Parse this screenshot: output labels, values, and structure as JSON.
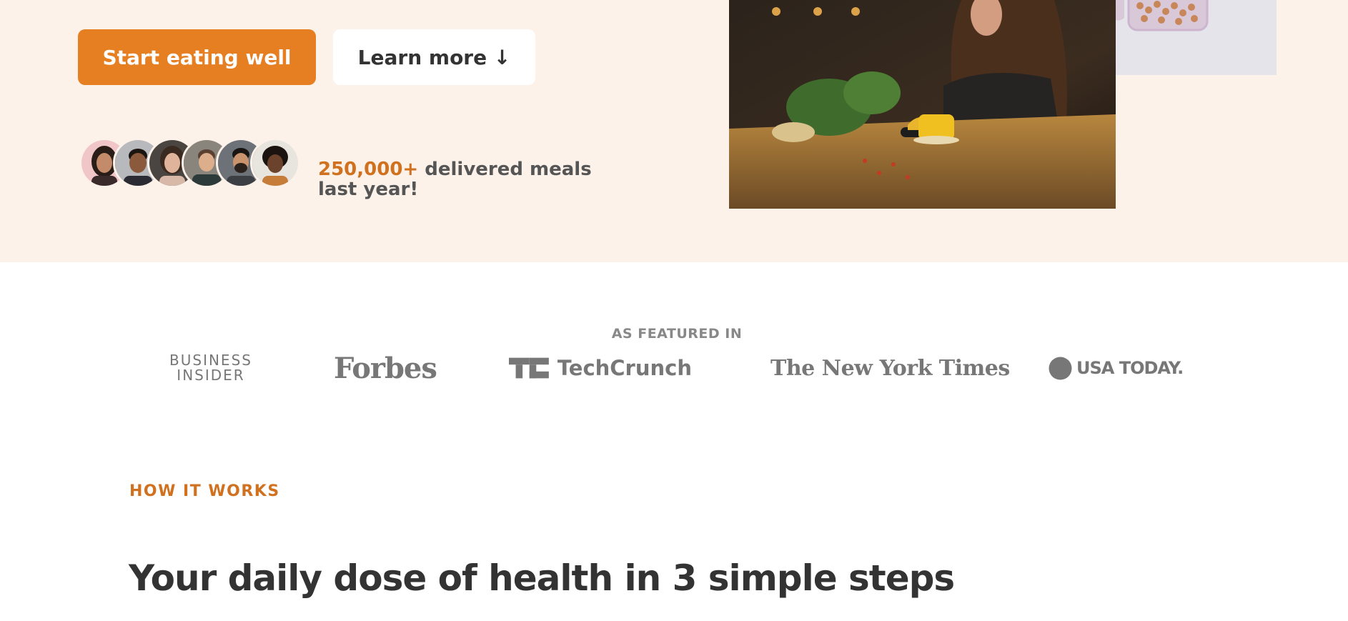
{
  "hero": {
    "primary_button": "Start eating well",
    "secondary_button": "Learn more ↓",
    "delivered_number": "250,000+",
    "delivered_text": " delivered meals last year!",
    "avatars": [
      "customer-1",
      "customer-2",
      "customer-3",
      "customer-4",
      "customer-5",
      "customer-6"
    ]
  },
  "featured": {
    "title": "AS FEATURED IN",
    "logos": {
      "business_insider_line1": "BUSINESS",
      "business_insider_line2": "INSIDER",
      "forbes": "Forbes",
      "techcrunch": "TechCrunch",
      "nyt": "The New York Times",
      "usa_today": "USA TODAY."
    }
  },
  "how_it_works": {
    "label": "HOW IT WORKS",
    "title": "Your daily dose of health in 3 simple steps"
  },
  "colors": {
    "accent": "#e67e22",
    "accent_text": "#cf711f",
    "hero_bg": "#fdf2e9"
  }
}
